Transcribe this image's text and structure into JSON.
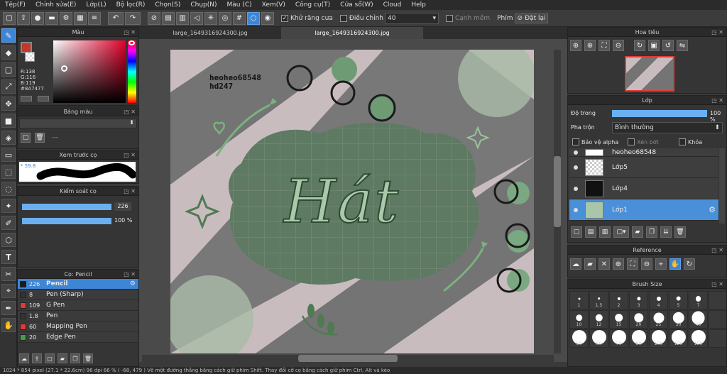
{
  "menu": [
    "Tệp(F)",
    "Chỉnh sửa(E)",
    "Lớp(L)",
    "Bộ lọc(R)",
    "Chọn(S)",
    "Chụp(N)",
    "Màu (C)",
    "Xem(V)",
    "Công cụ(T)",
    "Cửa sổ(W)",
    "Cloud",
    "Help"
  ],
  "toolbar": {
    "antialias_label": "Khử răng cưa",
    "adjust_label": "Điều chỉnh",
    "adjust_value": "40",
    "edge_label": "Cạnh mềm",
    "key_label": "Phím",
    "reset_label": "Đặt lại"
  },
  "tabs": [
    "large_1649316924300.jpg",
    "large_1649316924300.jpg"
  ],
  "color_panel": {
    "title": "Màu",
    "r": "R:138",
    "g": "G:116",
    "b": "B:119",
    "hex": "#8A7477",
    "primary": "#c0392b"
  },
  "palette_panel": {
    "title": "Bảng màu",
    "text": "---"
  },
  "preview_panel": {
    "title": "Xem trước cọ",
    "value": "* 59.8"
  },
  "control_panel": {
    "title": "Kiểm soát cọ",
    "size": "226",
    "opacity": "100 %"
  },
  "brush_panel": {
    "title": "Cọ: Pencil",
    "brushes": [
      {
        "size": "226",
        "name": "Pencil",
        "color": "#1a1a1a"
      },
      {
        "size": "8",
        "name": "Pen (Sharp)",
        "color": "#333"
      },
      {
        "size": "109",
        "name": "G Pen",
        "color": "#e53935"
      },
      {
        "size": "1.8",
        "name": "Pen",
        "color": "#333"
      },
      {
        "size": "60",
        "name": "Mapping Pen",
        "color": "#e53935"
      },
      {
        "size": "20",
        "name": "Edge Pen",
        "color": "#43a047"
      }
    ]
  },
  "navigator": {
    "title": "Hoa tiêu"
  },
  "layers": {
    "title": "Lớp",
    "opacity_label": "Độ trong",
    "opacity_value": "100 %",
    "blend_label": "Pha trộn",
    "blend_value": "Bình thường",
    "protect_alpha": "Bảo vệ alpha",
    "clipping": "Xén bớt",
    "lock": "Khóa",
    "items": [
      {
        "name": "heoheo68548"
      },
      {
        "name": "Lớp5"
      },
      {
        "name": "Lớp4"
      },
      {
        "name": "Lớp1"
      }
    ]
  },
  "reference": {
    "title": "Reference"
  },
  "brush_size": {
    "title": "Brush Size",
    "sizes": [
      "1",
      "1.5",
      "2",
      "3",
      "4",
      "5",
      "7",
      "",
      "10",
      "12",
      "15",
      "20",
      "25",
      "30",
      "40",
      "",
      "50",
      "60",
      "70",
      "80",
      "100",
      "120",
      "150",
      ""
    ]
  },
  "canvas": {
    "text1": "heoheo68548",
    "text2": "hd247",
    "title": "Hát"
  },
  "status": "1024 * 854 pixel  (27.1 * 22.6cm)  96 dpi  66 %  ( -68, 479 )  Vẽ một đường thẳng bằng cách giữ phím Shift. Thay đổi cỡ cọ bằng cách giữ phím Ctrl, Alt và kéo"
}
